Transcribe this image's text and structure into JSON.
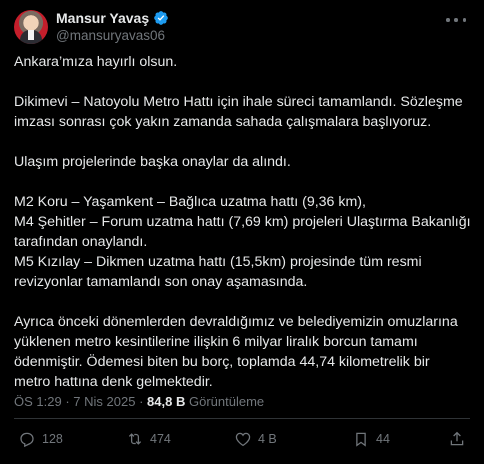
{
  "author": {
    "name": "Mansur Yavaş",
    "handle": "@mansuryavas06"
  },
  "post": {
    "paragraphs": [
      [
        "Ankara’mıza hayırlı olsun."
      ],
      [
        "Dikimevi – Natoyolu Metro Hattı için ihale süreci tamamlandı. Sözleşme",
        "imzası sonrası çok yakın zamanda sahada çalışmalara başlıyoruz."
      ],
      [
        "Ulaşım projelerinde başka onaylar da alındı."
      ],
      [
        "M2 Koru – Yaşamkent – Bağlıca uzatma hattı (9,36 km),",
        "M4 Şehitler – Forum uzatma hattı (7,69 km) projeleri Ulaştırma Bakanlığı",
        "tarafından onaylandı.",
        "M5 Kızılay – Dikmen uzatma hattı (15,5km) projesinde tüm resmi",
        "revizyonlar tamamlandı son onay aşamasında."
      ],
      [
        "Ayrıca önceki dönemlerden devraldığımız ve belediyemizin omuzlarına",
        "yüklenen metro kesintilerine ilişkin 6 milyar liralık borcun tamamı",
        "ödenmiştir. Ödemesi biten bu borç, toplamda 44,74 kilometrelik bir",
        "metro hattına denk gelmektedir."
      ]
    ]
  },
  "meta": {
    "time": "ÖS 1:29",
    "separator": "·",
    "date": "7 Nis 2025",
    "views_count": "84,8 B",
    "views_label": "Görüntüleme"
  },
  "actions": {
    "replies": "128",
    "reposts": "474",
    "likes": "4 B",
    "views": "44"
  },
  "colors": {
    "background": "#000000",
    "text": "#e7e9ea",
    "muted": "#71767b",
    "verified": "#1d9bf0"
  }
}
